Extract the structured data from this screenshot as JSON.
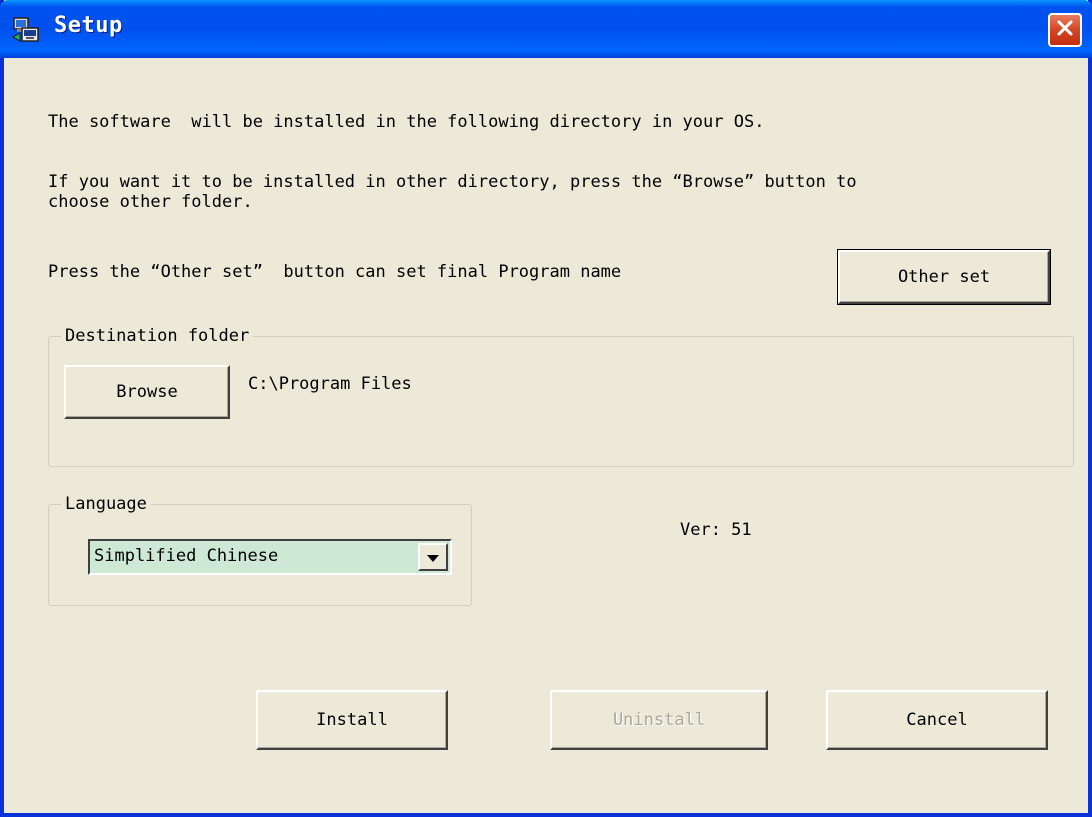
{
  "window": {
    "title": "Setup"
  },
  "instructions": {
    "line1": "The software  will be installed in the following directory in your OS.",
    "line2a": "If you want it to be installed in other directory, press the “Browse” button to",
    "line2b": "choose other folder.",
    "line3": "Press the “Other set”  button can set final Program name"
  },
  "buttons": {
    "other_set": "Other set",
    "browse": "Browse",
    "install": "Install",
    "uninstall": "Uninstall",
    "cancel": "Cancel"
  },
  "destination": {
    "label": "Destination folder",
    "path": "C:\\Program Files"
  },
  "language": {
    "label": "Language",
    "selected": "Simplified Chinese"
  },
  "version": "Ver: 51",
  "icons": {
    "app": "setup-computer-icon",
    "close": "close-icon",
    "dropdown": "chevron-down-icon"
  },
  "colors": {
    "titlebar": "#0054e3",
    "window_bg": "#ece9d8",
    "combo_bg": "#cde8d4",
    "close_red": "#d34626"
  }
}
